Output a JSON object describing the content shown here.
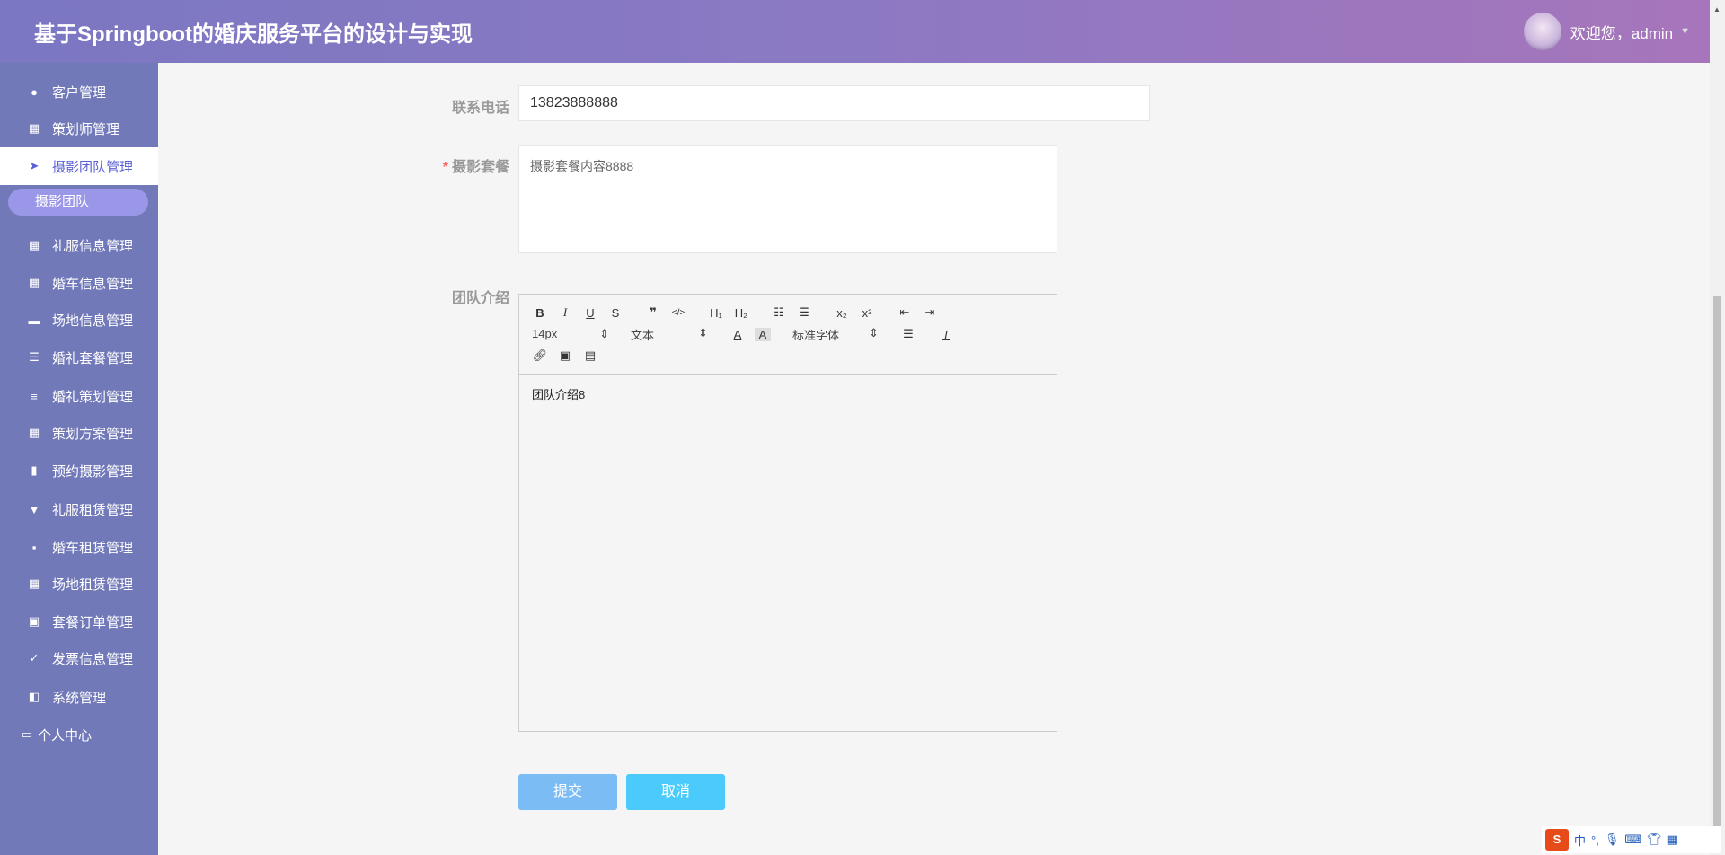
{
  "header": {
    "title": "基于Springboot的婚庆服务平台的设计与实现",
    "welcome": "欢迎您，admin"
  },
  "sidebar": {
    "items": [
      {
        "label": "客户管理",
        "icon": "bulb-icon"
      },
      {
        "label": "策划师管理",
        "icon": "grid-icon"
      },
      {
        "label": "摄影团队管理",
        "icon": "send-icon"
      },
      {
        "label": "礼服信息管理",
        "icon": "grid-icon"
      },
      {
        "label": "婚车信息管理",
        "icon": "grid-icon"
      },
      {
        "label": "场地信息管理",
        "icon": "ticket-icon"
      },
      {
        "label": "婚礼套餐管理",
        "icon": "sliders-icon"
      },
      {
        "label": "婚礼策划管理",
        "icon": "list-icon"
      },
      {
        "label": "策划方案管理",
        "icon": "grid-icon"
      },
      {
        "label": "预约摄影管理",
        "icon": "book-icon"
      },
      {
        "label": "礼服租赁管理",
        "icon": "brush-icon"
      },
      {
        "label": "婚车租赁管理",
        "icon": "chat-icon"
      },
      {
        "label": "场地租赁管理",
        "icon": "grid-icon"
      },
      {
        "label": "套餐订单管理",
        "icon": "chart-icon"
      },
      {
        "label": "发票信息管理",
        "icon": "clipboard-icon"
      },
      {
        "label": "系统管理",
        "icon": "wallet-icon"
      }
    ],
    "sub_item": "摄影团队",
    "personal": "个人中心"
  },
  "form": {
    "phone_label": "联系电话",
    "phone_value": "13823888888",
    "package_label": "摄影套餐",
    "package_value": "摄影套餐内容8888",
    "intro_label": "团队介绍",
    "intro_value": "团队介绍8",
    "toolbar": {
      "size": "14px",
      "header": "文本",
      "font": "标准字体"
    },
    "submit": "提交",
    "cancel": "取消"
  },
  "ime": {
    "lang": "中"
  }
}
